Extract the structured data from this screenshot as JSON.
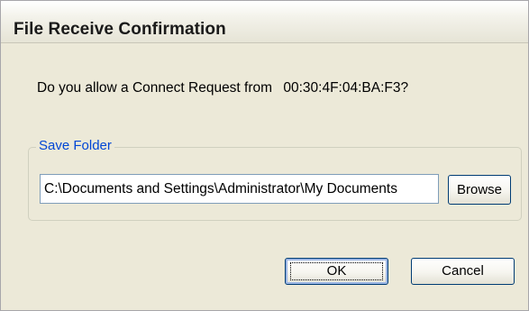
{
  "window": {
    "title": "File Receive Confirmation"
  },
  "prompt": {
    "question": "Do you allow a Connect Request from",
    "address": "00:30:4F:04:BA:F3?"
  },
  "save_folder": {
    "label": "Save Folder",
    "path": "C:\\Documents and Settings\\Administrator\\My Documents",
    "browse_label": "Browse"
  },
  "buttons": {
    "ok_label": "OK",
    "cancel_label": "Cancel"
  },
  "colors": {
    "dialog_background": "#ece9d8",
    "group_label": "#0046d5",
    "button_border": "#003c74",
    "input_border": "#7f9db9"
  }
}
